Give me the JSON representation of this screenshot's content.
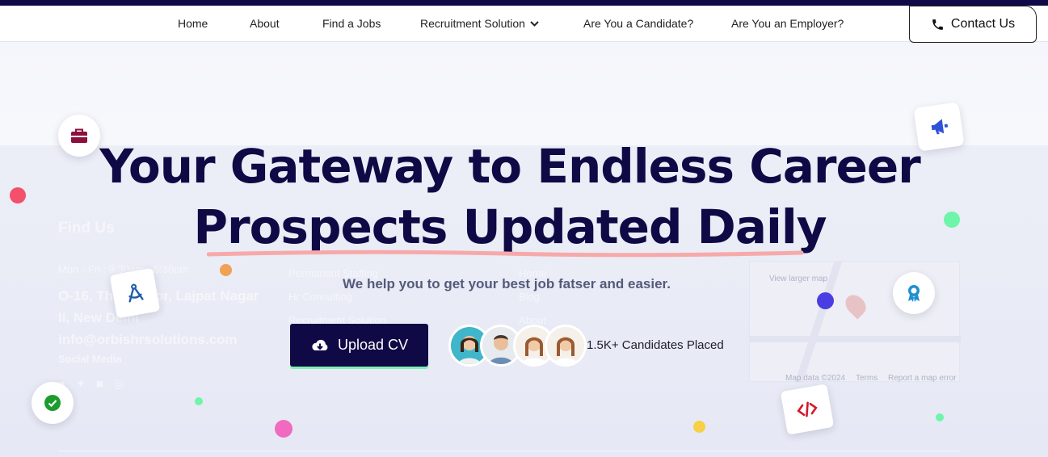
{
  "nav": {
    "items": [
      "Home",
      "About",
      "Find a Jobs",
      "Recruitment Solution",
      "Are You a Candidate?",
      "Are You an Employer?"
    ],
    "contact_label": "Contact Us"
  },
  "hero": {
    "title_line1": "Your Gateway to Endless Career",
    "title_line2": "Prospects Updated Daily",
    "subtitle": "We help you to get your best job fatser and easier.",
    "upload_label": "Upload CV",
    "placed_text": "1.5K+ Candidates Placed"
  },
  "background_footer": {
    "find_us_heading": "Find Us",
    "hours": "Mon - Fri : 9:30am - 6:30pm",
    "address_line1": "O-16, Third Floor, Lajpat Nagar",
    "address_line2": "II, New Delhi",
    "email": "info@orbishrsolutions.com",
    "social_heading": "Social Media",
    "services": [
      "Permanent Staffing",
      "Hr Consulting",
      "Recruitment Solution"
    ],
    "links": [
      "Home",
      "Blog",
      "About"
    ],
    "map_labels": [
      "View larger map",
      "Map data ©2024",
      "Terms",
      "Report a map error"
    ]
  },
  "colors": {
    "brand_navy": "#0f0a45",
    "underline_pink": "#f7a9a9",
    "accent_green": "#7cf2b5"
  },
  "icons": {
    "briefcase": "briefcase-icon",
    "megaphone": "megaphone-icon",
    "compass": "drafting-compass-icon",
    "badge": "award-badge-icon",
    "check": "check-circle-icon",
    "code": "code-icon",
    "phone": "phone-icon",
    "upload": "cloud-upload-icon"
  }
}
